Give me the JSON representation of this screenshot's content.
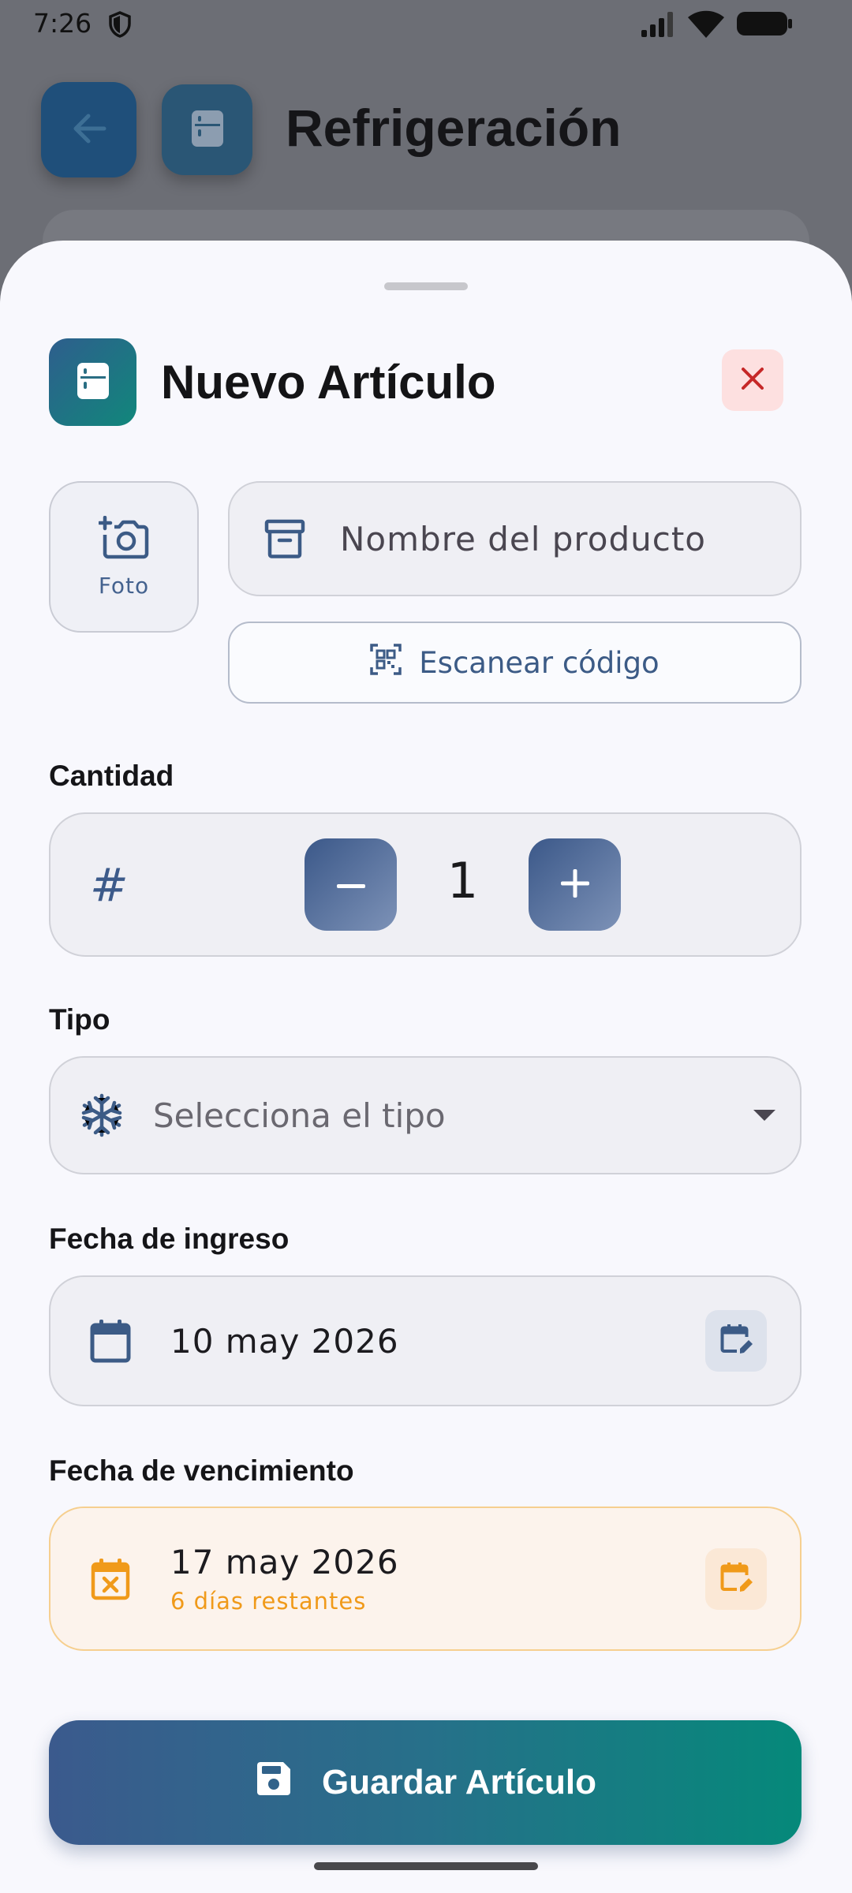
{
  "status_bar": {
    "time": "7:26"
  },
  "background_screen": {
    "title": "Refrigeración"
  },
  "sheet": {
    "title": "Nuevo Artículo",
    "photo_label": "Foto",
    "name_placeholder": "Nombre del producto",
    "scan_label": "Escanear código",
    "quantity_label": "Cantidad",
    "quantity_symbol": "#",
    "quantity_value": "1",
    "type_label": "Tipo",
    "type_placeholder": "Selecciona el tipo",
    "entry_date_label": "Fecha de ingreso",
    "entry_date_value": "10 may 2026",
    "expiry_date_label": "Fecha de vencimiento",
    "expiry_date_value": "17 may 2026",
    "expiry_remaining": "6 días restantes",
    "save_label": "Guardar Artículo"
  },
  "icons": {
    "status": [
      "shield-icon",
      "signal-icon",
      "wifi-icon",
      "battery-icon"
    ],
    "fields": [
      "fridge-icon",
      "close-icon",
      "add-photo-icon",
      "archive-box-icon",
      "qr-scan-icon",
      "minus-icon",
      "plus-icon",
      "snowflake-icon",
      "dropdown-caret-icon",
      "calendar-icon",
      "calendar-edit-icon",
      "calendar-x-icon",
      "save-disk-icon"
    ]
  },
  "colors": {
    "accent_blue": "#3c5b86",
    "accent_teal": "#05897a",
    "warning_orange": "#f09a1a",
    "close_red": "#c62828"
  }
}
